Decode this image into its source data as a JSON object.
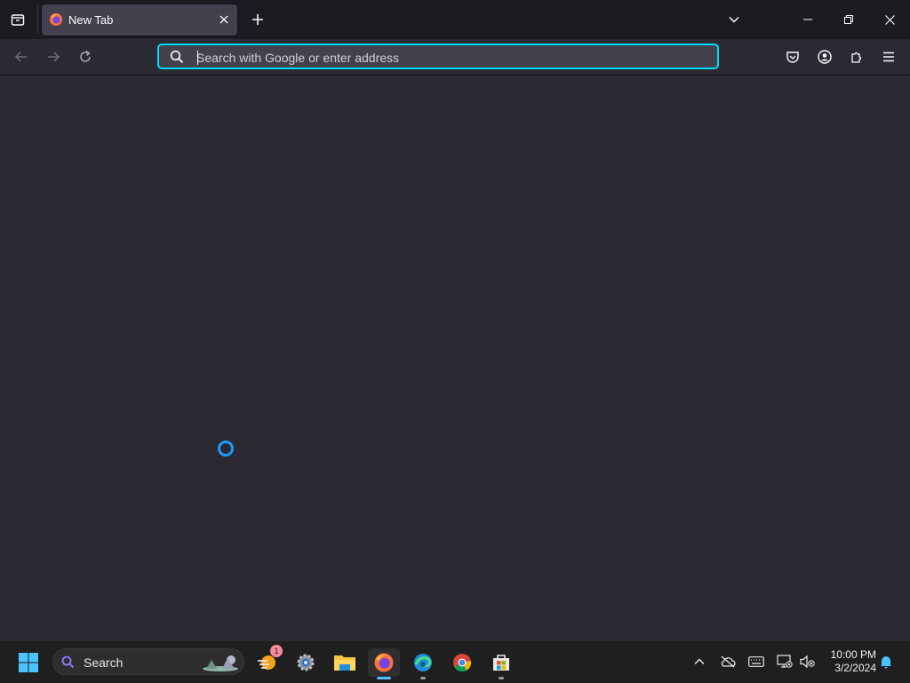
{
  "browser": {
    "tab": {
      "title": "New Tab",
      "favicon": "firefox-icon"
    },
    "urlbar": {
      "placeholder": "Search with Google or enter address",
      "value": ""
    },
    "accent": "#00ddff"
  },
  "taskbar": {
    "search_label": "Search",
    "widgets_badge": "1",
    "pinned": [
      "widgets",
      "settings",
      "file-explorer",
      "firefox",
      "edge",
      "chrome",
      "microsoft-store"
    ],
    "active": "firefox"
  },
  "clock": {
    "time": "10:00 PM",
    "date": "3/2/2024"
  }
}
